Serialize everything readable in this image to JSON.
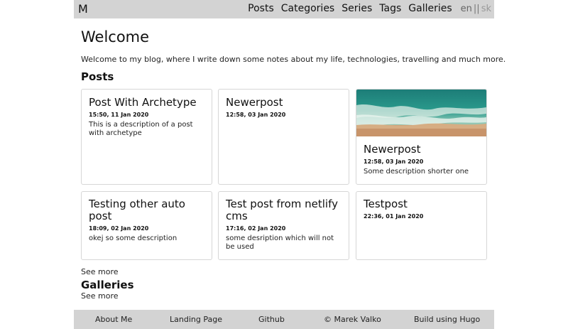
{
  "navbar": {
    "logo": "M",
    "links": [
      "Posts",
      "Categories",
      "Series",
      "Tags",
      "Galleries"
    ],
    "lang": {
      "active": "en",
      "separator": "||",
      "other": "sk"
    }
  },
  "main": {
    "title": "Welcome",
    "intro": "Welcome to my blog, where I write down some notes about my life, technologies, travelling and much more.",
    "posts_heading": "Posts",
    "posts": [
      {
        "title": "Post With Archetype",
        "date": "15:50, 11 Jan 2020",
        "description": "This is a description of a post with archetype"
      },
      {
        "title": "Newerpost",
        "date": "12:58, 03 Jan 2020",
        "description": ""
      },
      {
        "title": "Newerpost",
        "date": "12:58, 03 Jan 2020",
        "description": "Some description shorter one",
        "image": "beach-aerial-image"
      },
      {
        "title": "Testing other auto post",
        "date": "18:09, 02 Jan 2020",
        "description": "okej so some description"
      },
      {
        "title": "Test post from netlify cms",
        "date": "17:16, 02 Jan 2020",
        "description": "some desription which will not be used"
      },
      {
        "title": "Testpost",
        "date": "22:36, 01 Jan 2020",
        "description": ""
      }
    ],
    "posts_see_more": "See more",
    "galleries_heading": "Galleries",
    "galleries_see_more": "See more"
  },
  "footer": {
    "items": [
      "About Me",
      "Landing Page",
      "Github",
      "© Marek Valko",
      "Build using Hugo"
    ]
  },
  "colors": {
    "bar_background": "#d3d3d3",
    "card_border": "#d6d6d6"
  }
}
